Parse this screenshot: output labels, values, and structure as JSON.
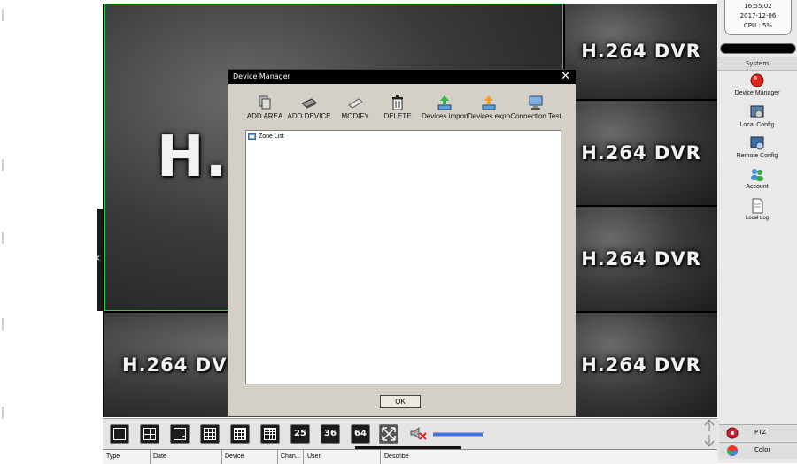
{
  "video": {
    "tile_text": "H.264 DVR",
    "big_tile_text": "H.264 DVR",
    "left_tile_text": "H.264 DVR"
  },
  "dialog": {
    "title": "Device Manager",
    "close_glyph": "✕",
    "toolbar": [
      {
        "label": "ADD AREA",
        "icon": "add-area-icon"
      },
      {
        "label": "ADD DEVICE",
        "icon": "add-device-icon"
      },
      {
        "label": "MODIFY",
        "icon": "modify-icon"
      },
      {
        "label": "DELETE",
        "icon": "delete-icon"
      },
      {
        "label": "Devices import",
        "icon": "import-icon"
      },
      {
        "label": "Devices expor",
        "icon": "export-icon"
      },
      {
        "label": "Connection  Test",
        "icon": "connection-test-icon"
      }
    ],
    "tree_root": "Zone List",
    "ok_label": "OK"
  },
  "sidebar": {
    "time": "16:55:02",
    "date": "2017-12-06",
    "cpu": "CPU : 5%",
    "section": "System",
    "items": [
      {
        "label": "Device Manager",
        "icon": "device-manager-icon"
      },
      {
        "label": "Local Config",
        "icon": "local-config-icon"
      },
      {
        "label": "Remote Config",
        "icon": "remote-config-icon"
      },
      {
        "label": "Account",
        "icon": "account-icon"
      },
      {
        "label": "Local Log",
        "icon": "local-log-icon"
      }
    ],
    "bottom": [
      {
        "label": "PTZ",
        "icon": "ptz-icon"
      },
      {
        "label": "Color",
        "icon": "color-icon"
      }
    ]
  },
  "layout_buttons": [
    "",
    "",
    "",
    "",
    "",
    "",
    "25",
    "36",
    "64"
  ],
  "log_columns": [
    "Type",
    "Date",
    "Device",
    "Chan...",
    "User",
    "Describe"
  ]
}
